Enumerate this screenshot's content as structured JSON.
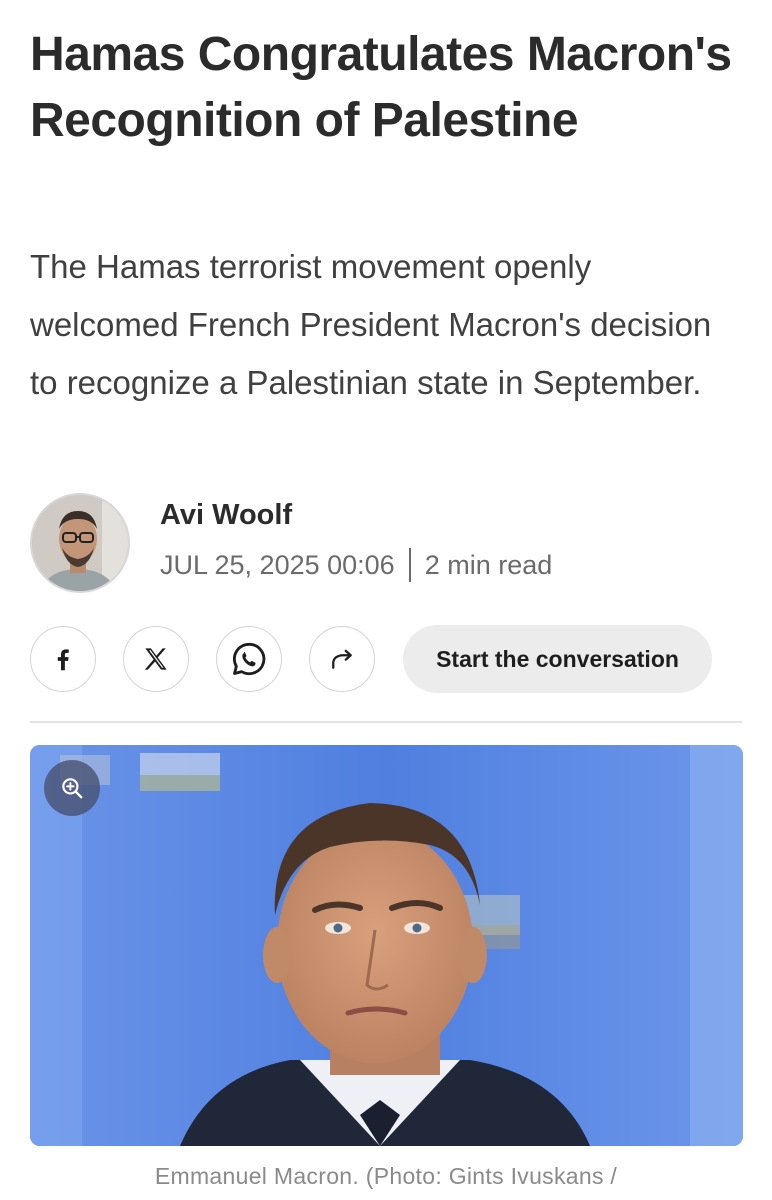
{
  "article": {
    "headline": "Hamas Congratulates Macron's Recognition of Palestine",
    "subheadline": "The Hamas terrorist movement openly welcomed French President Macron's decision to recognize a Palestinian state in September."
  },
  "byline": {
    "author": "Avi Woolf",
    "date": "JUL 25, 2025 00:06",
    "read_time": "2 min read"
  },
  "share": {
    "icons": [
      "facebook-icon",
      "x-icon",
      "whatsapp-icon",
      "share-arrow-icon"
    ],
    "conversation_label": "Start the conversation"
  },
  "image": {
    "caption": "Emmanuel Macron. (Photo: Gints Ivuskans /",
    "zoom_icon": "zoom-in-icon",
    "background_color": "#5a86e0"
  }
}
